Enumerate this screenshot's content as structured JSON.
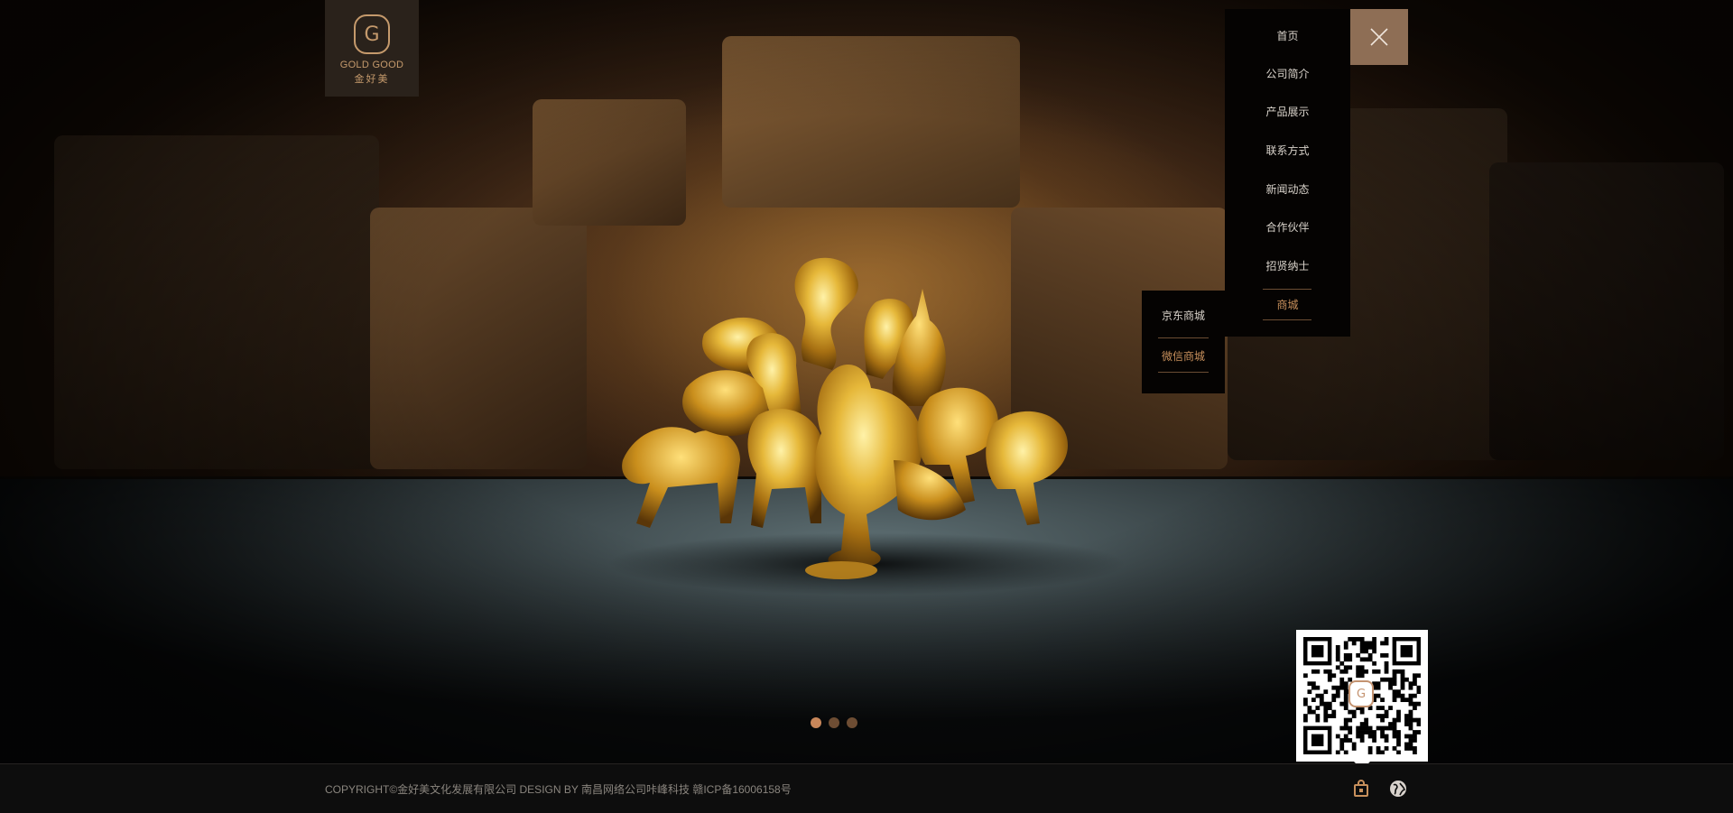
{
  "brand": {
    "name_en": "GOLD GOOD",
    "name_cn": "金好美",
    "logo_glyph": "G"
  },
  "nav": {
    "items": [
      {
        "label": "首页"
      },
      {
        "label": "公司简介"
      },
      {
        "label": "产品展示"
      },
      {
        "label": "联系方式"
      },
      {
        "label": "新闻动态"
      },
      {
        "label": "合作伙伴"
      },
      {
        "label": "招贤纳士"
      },
      {
        "label": "商城",
        "active": true
      }
    ],
    "close_icon": "close-icon"
  },
  "submenu": {
    "items": [
      {
        "label": "京东商城"
      },
      {
        "label": "微信商城",
        "active": true
      }
    ]
  },
  "slider": {
    "dot_count": 3,
    "active_index": 0
  },
  "qr": {
    "badge_glyph": "G"
  },
  "footer": {
    "copyright": "COPYRIGHT©金好美文化发展有限公司 DESIGN BY 南昌网络公司咔峰科技  赣ICP备16006158号",
    "icons": [
      "shopping-bag-icon",
      "globe-icon"
    ]
  },
  "colors": {
    "accent": "#c8905c",
    "menu_bg": "#050302",
    "close_bg": "#8e6e55",
    "logo_gold": "#c59a6c"
  }
}
